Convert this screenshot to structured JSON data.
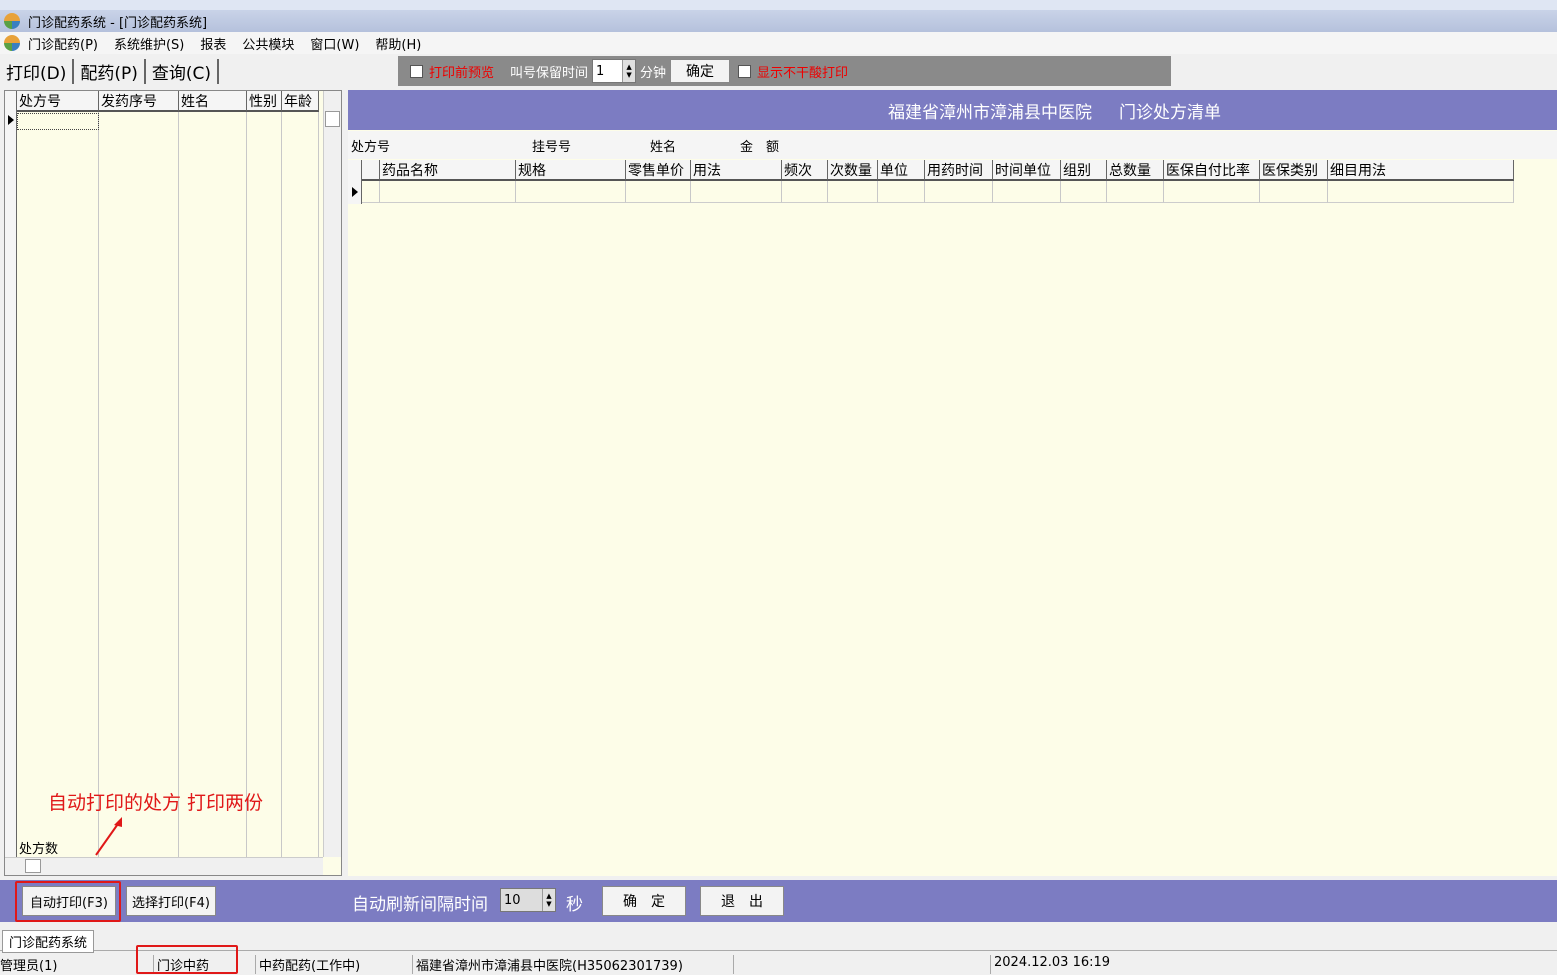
{
  "window": {
    "title": "门诊配药系统 - [门诊配药系统]"
  },
  "menu": [
    "门诊配药(P)",
    "系统维护(S)",
    "报表",
    "公共模块",
    "窗口(W)",
    "帮助(H)"
  ],
  "toolbar": [
    "打印(D)",
    "配药(P)",
    "查询(C)"
  ],
  "options": {
    "print_preview": "打印前预览",
    "retain_label": "叫号保留时间",
    "retain_value": "1",
    "minutes": "分钟",
    "confirm": "确定",
    "show_no_dry": "显示不干酸打印"
  },
  "left_grid": {
    "columns": [
      "处方号",
      "发药序号",
      "姓名",
      "性别",
      "年龄"
    ],
    "footer": "处方数"
  },
  "right": {
    "header": "福建省漳州市漳浦县中医院     门诊处方清单",
    "info": [
      "处方号",
      "挂号号",
      "姓名",
      "金　额"
    ],
    "columns": [
      "药品名称",
      "规格",
      "零售单价",
      "用法",
      "频次",
      "次数量",
      "单位",
      "用药时间",
      "时间单位",
      "组别",
      "总数量",
      "医保自付比率",
      "医保类别",
      "细目用法"
    ]
  },
  "annotation": "自动打印的处方 打印两份",
  "bottom": {
    "auto_print": "自动打印(F3)",
    "select_print": "选择打印(F4)",
    "refresh_label": "自动刷新间隔时间",
    "refresh_value": "10",
    "seconds": "秒",
    "confirm": "确　定",
    "exit": "退　出"
  },
  "tab": "门诊配药系统",
  "status": [
    "管理员(1)",
    "门诊中药",
    "中药配药(工作中)",
    "福建省漳州市漳浦县中医院(H35062301739)",
    "",
    "2024.12.03 16:19"
  ],
  "colors": {
    "accent": "#7c7cc2",
    "grid_bg": "#fdfde8",
    "highlight": "#e01818"
  }
}
